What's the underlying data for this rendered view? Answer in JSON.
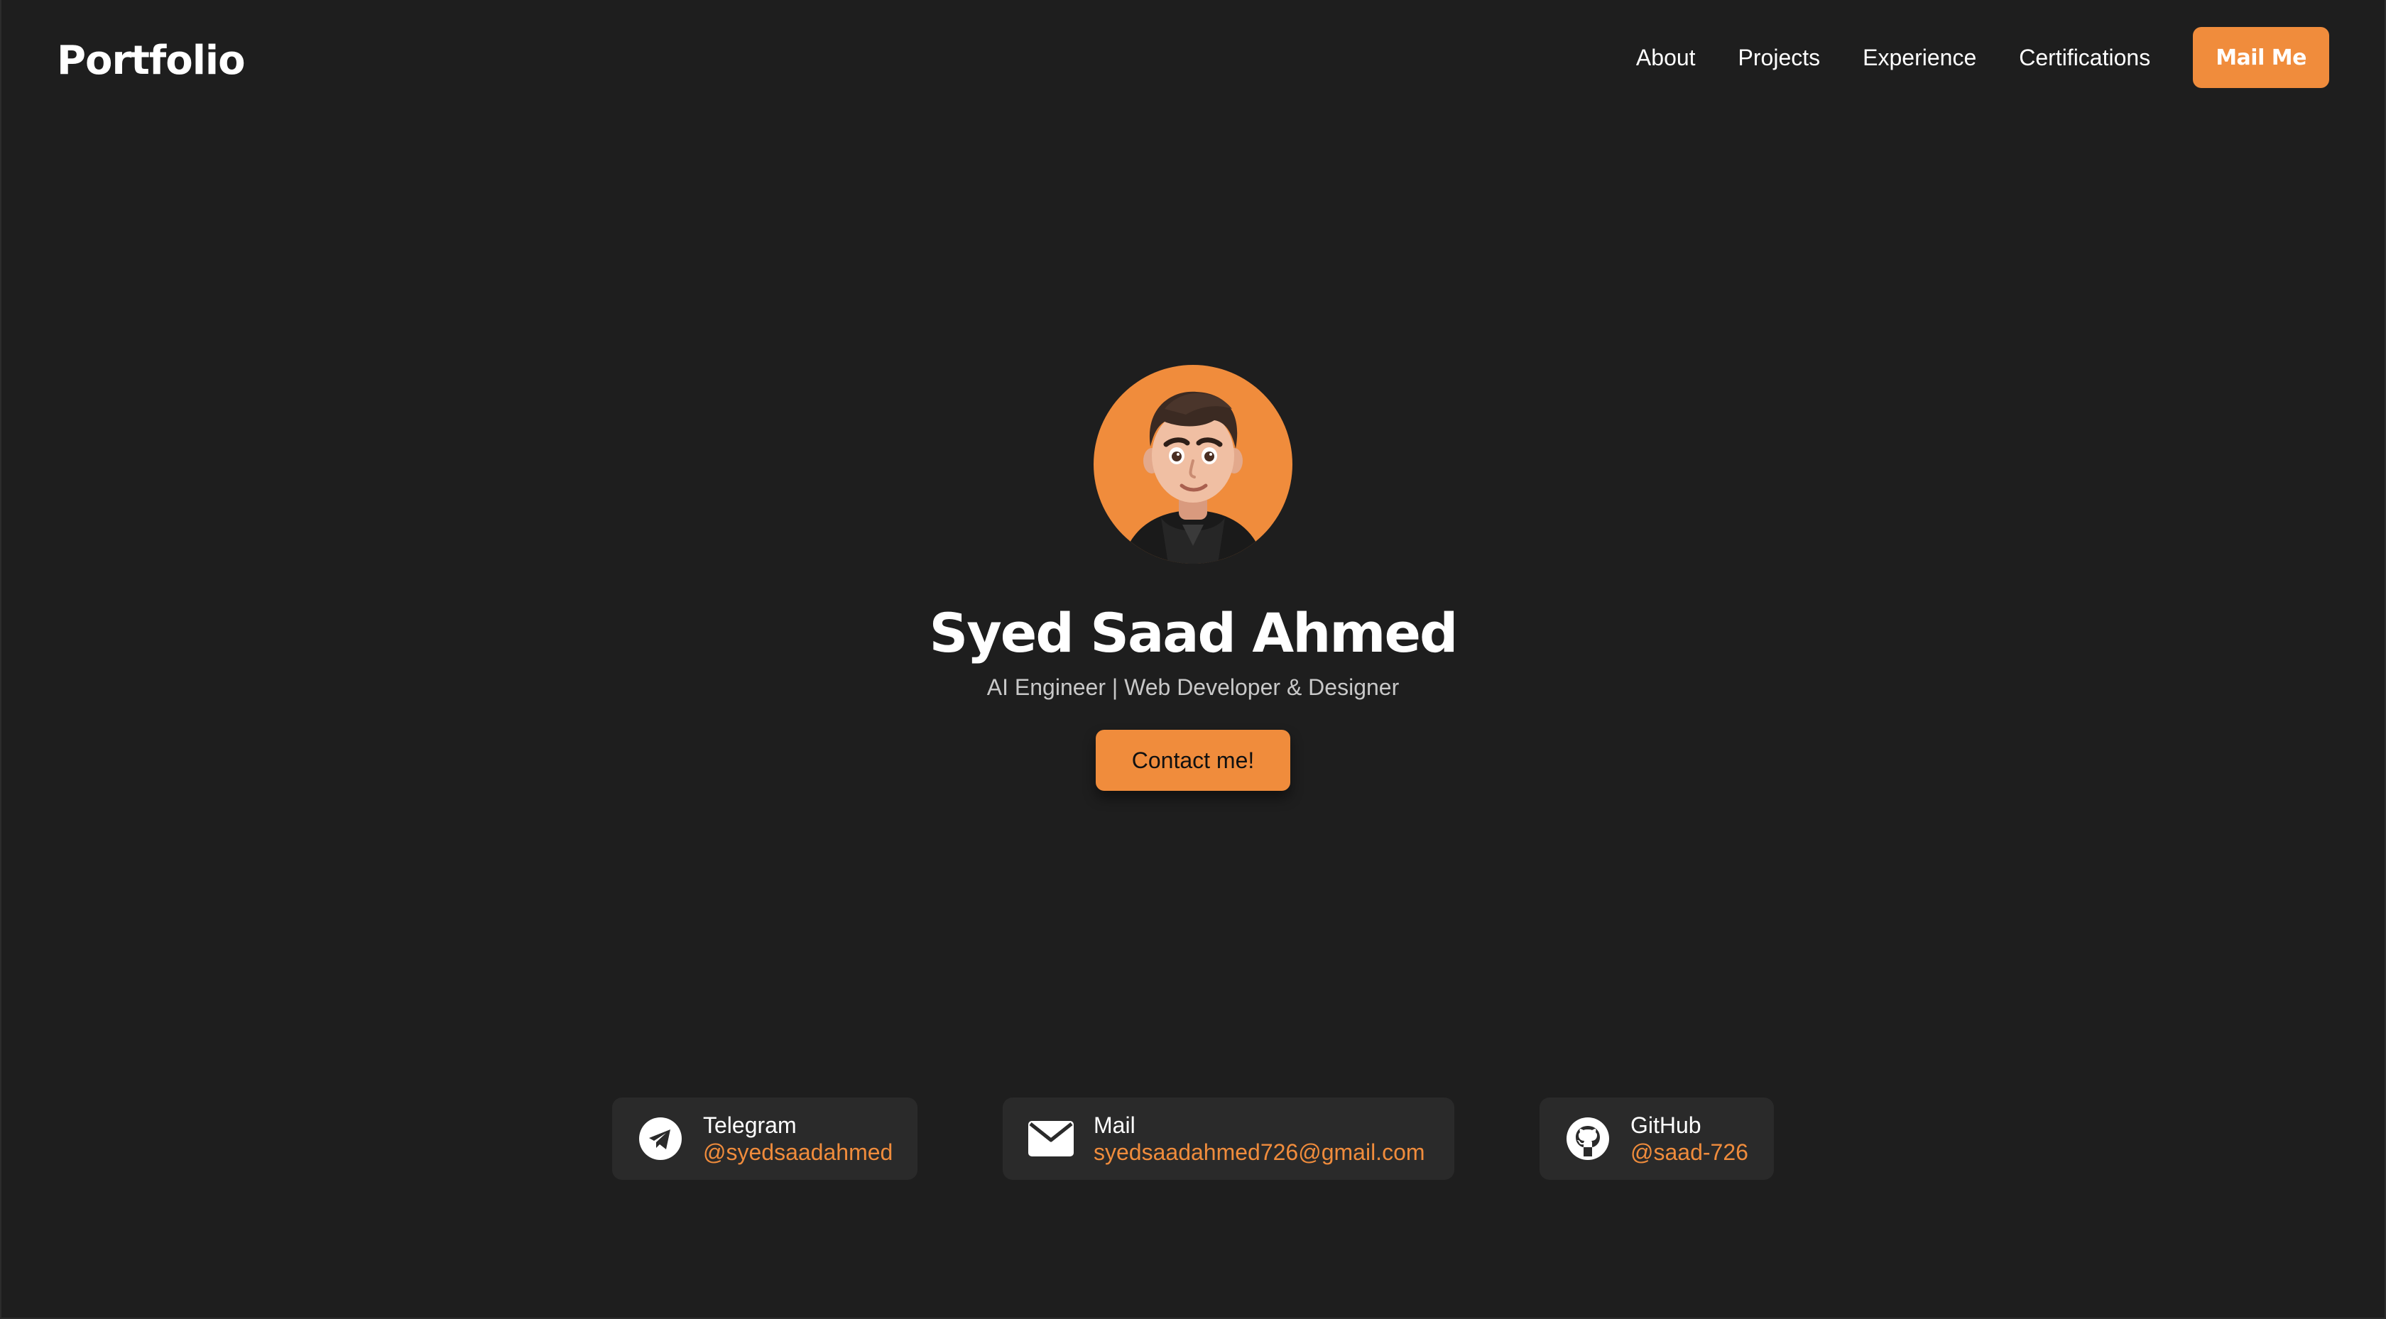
{
  "header": {
    "brand": "Portfolio",
    "nav": [
      {
        "label": "About"
      },
      {
        "label": "Projects"
      },
      {
        "label": "Experience"
      },
      {
        "label": "Certifications"
      }
    ],
    "mail_button": "Mail Me"
  },
  "hero": {
    "avatar_icon": "avatar-illustration",
    "name": "Syed Saad Ahmed",
    "subtitle": "AI Engineer | Web Developer & Designer",
    "cta": "Contact me!"
  },
  "contacts": [
    {
      "icon": "telegram-icon",
      "title": "Telegram",
      "value": "@syedsaadahmed"
    },
    {
      "icon": "mail-icon",
      "title": "Mail",
      "value": "syedsaadahmed726@gmail.com"
    },
    {
      "icon": "github-icon",
      "title": "GitHub",
      "value": "@saad-726"
    }
  ],
  "colors": {
    "background": "#1e1e1e",
    "accent": "#f08c3c",
    "card": "#2a2a2a",
    "text": "#ffffff",
    "muted_text": "#c8c8c8"
  }
}
